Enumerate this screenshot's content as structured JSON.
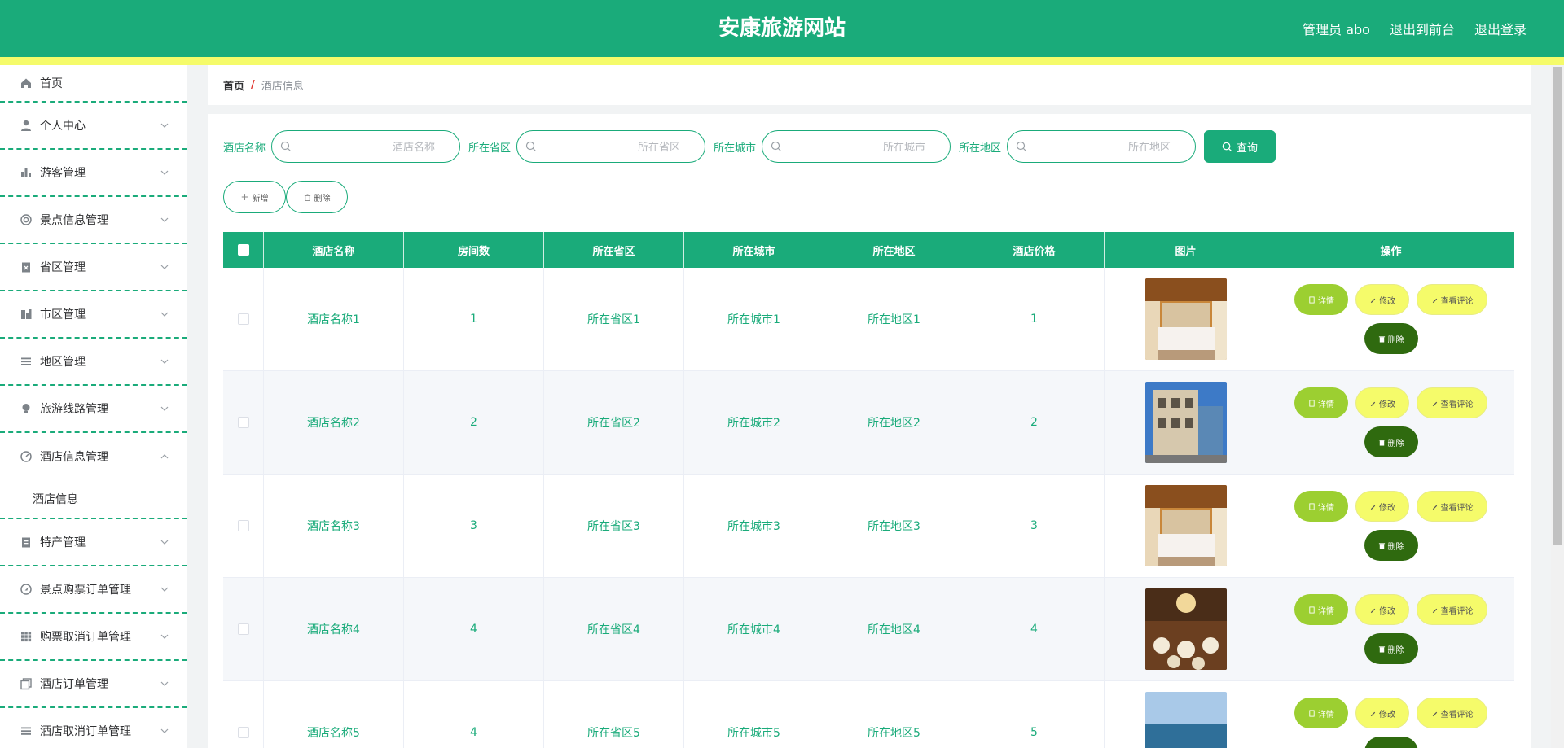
{
  "header": {
    "title": "安康旅游网站",
    "user": "管理员 abo",
    "to_front": "退出到前台",
    "logout": "退出登录"
  },
  "sidebar": {
    "items": [
      {
        "label": "首页",
        "icon": "home-icon"
      },
      {
        "label": "个人中心",
        "icon": "user-icon"
      },
      {
        "label": "游客管理",
        "icon": "bar-chart-icon"
      },
      {
        "label": "景点信息管理",
        "icon": "lifebuoy-icon"
      },
      {
        "label": "省区管理",
        "icon": "clipboard-x-icon"
      },
      {
        "label": "市区管理",
        "icon": "buildings-icon"
      },
      {
        "label": "地区管理",
        "icon": "list-icon"
      },
      {
        "label": "旅游线路管理",
        "icon": "lightbulb-icon"
      },
      {
        "label": "酒店信息管理",
        "icon": "gauge-icon"
      },
      {
        "label": "特产管理",
        "icon": "clipboard-icon"
      },
      {
        "label": "景点购票订单管理",
        "icon": "compass-icon"
      },
      {
        "label": "购票取消订单管理",
        "icon": "grid-icon"
      },
      {
        "label": "酒店订单管理",
        "icon": "copy-icon"
      },
      {
        "label": "酒店取消订单管理",
        "icon": "menu-icon"
      }
    ],
    "submenu_label": "酒店信息"
  },
  "breadcrumb": {
    "home": "首页",
    "separator": "/",
    "current": "酒店信息"
  },
  "filters": {
    "name_label": "酒店名称",
    "name_placeholder": "酒店名称",
    "province_label": "所在省区",
    "province_placeholder": "所在省区",
    "city_label": "所在城市",
    "city_placeholder": "所在城市",
    "district_label": "所在地区",
    "district_placeholder": "所在地区",
    "query_label": "查询"
  },
  "actions": {
    "add_label": "新增",
    "delete_label": "删除"
  },
  "table": {
    "headers": [
      "酒店名称",
      "房间数",
      "所在省区",
      "所在城市",
      "所在地区",
      "酒店价格",
      "图片",
      "操作"
    ],
    "rows": [
      {
        "name": "酒店名称1",
        "rooms": "1",
        "province": "所在省区1",
        "city": "所在城市1",
        "district": "所在地区1",
        "price": "1"
      },
      {
        "name": "酒店名称2",
        "rooms": "2",
        "province": "所在省区2",
        "city": "所在城市2",
        "district": "所在地区2",
        "price": "2"
      },
      {
        "name": "酒店名称3",
        "rooms": "3",
        "province": "所在省区3",
        "city": "所在城市3",
        "district": "所在地区3",
        "price": "3"
      },
      {
        "name": "酒店名称4",
        "rooms": "4",
        "province": "所在省区4",
        "city": "所在城市4",
        "district": "所在地区4",
        "price": "4"
      },
      {
        "name": "酒店名称5",
        "rooms": "4",
        "province": "所在省区5",
        "city": "所在城市5",
        "district": "所在地区5",
        "price": "5"
      }
    ],
    "op_labels": {
      "detail": "详情",
      "edit": "修改",
      "review": "查看评论",
      "delete": "删除"
    }
  },
  "colors": {
    "primary": "#1aab7a",
    "highlight": "#f5fb6a",
    "detail_button": "#9ccf31",
    "delete_button": "#2f6a0f"
  }
}
